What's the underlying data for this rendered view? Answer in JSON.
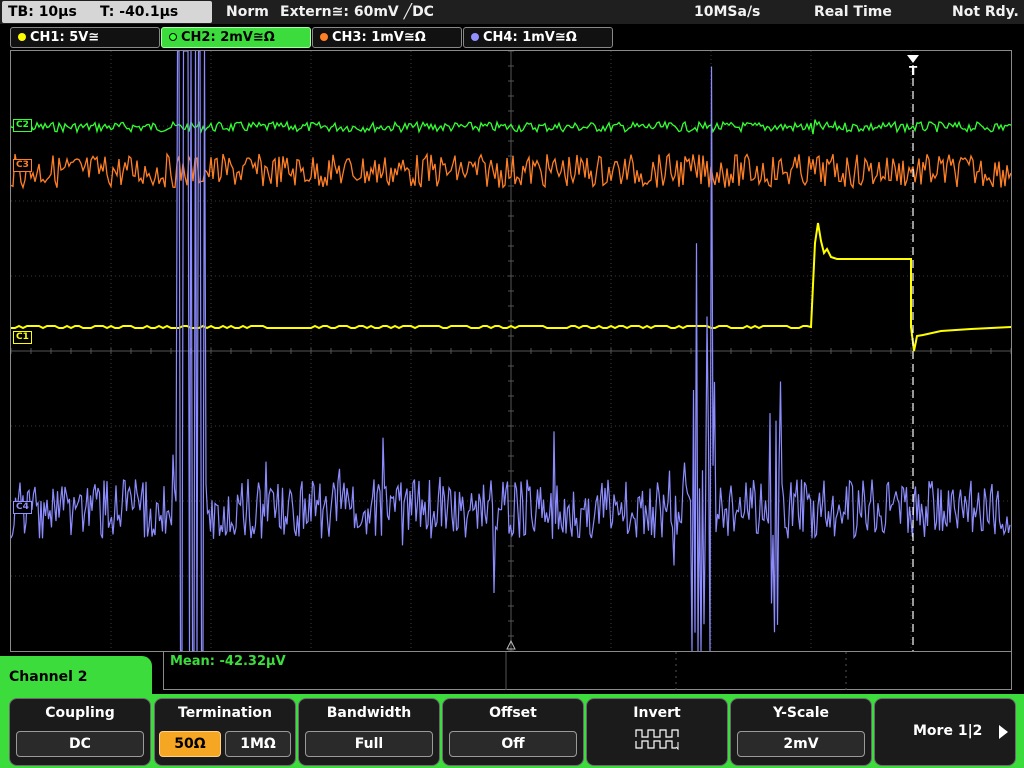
{
  "header": {
    "timebase": "TB: 10µs",
    "trigger_time": "T: -40.1µs",
    "mode": "Norm",
    "trigger_source": "Extern≅: 60mV ╱DC",
    "sample_rate": "10MSa/s",
    "acq_mode": "Real Time",
    "status": "Not Rdy."
  },
  "channels": [
    {
      "label": "CH1: 5V≅",
      "color": "#ffff00",
      "active": false,
      "marker": "C1"
    },
    {
      "label": "CH2: 2mV≅Ω",
      "color": "#33ff33",
      "active": true,
      "marker": "C2"
    },
    {
      "label": "CH3: 1mV≅Ω",
      "color": "#ff7f27",
      "active": false,
      "marker": "C3"
    },
    {
      "label": "CH4: 1mV≅Ω",
      "color": "#9090ff",
      "active": false,
      "marker": "C4"
    }
  ],
  "measurement": {
    "label": "Mean: -42.32µV"
  },
  "menu": {
    "title": "Channel 2"
  },
  "softkeys": {
    "coupling": {
      "title": "Coupling",
      "value": "DC"
    },
    "termination": {
      "title": "Termination",
      "options": [
        "50Ω",
        "1MΩ"
      ],
      "selected": 0
    },
    "bandwidth": {
      "title": "Bandwidth",
      "value": "Full"
    },
    "offset": {
      "title": "Offset",
      "value": "Off"
    },
    "invert": {
      "title": "Invert"
    },
    "yscale": {
      "title": "Y-Scale",
      "value": "2mV"
    },
    "more": {
      "label": "More 1|2"
    }
  }
}
